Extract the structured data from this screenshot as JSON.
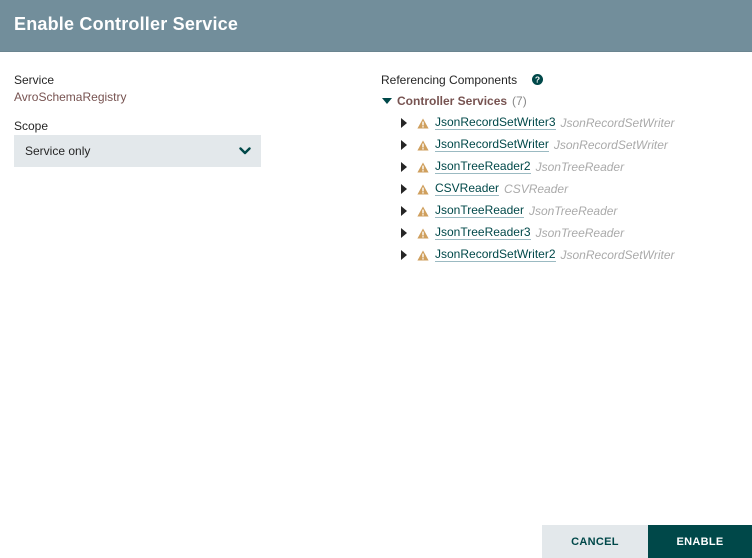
{
  "dialog": {
    "title": "Enable Controller Service"
  },
  "service": {
    "label": "Service",
    "value": "AvroSchemaRegistry"
  },
  "scope": {
    "label": "Scope",
    "selected": "Service only"
  },
  "referencing": {
    "label": "Referencing Components",
    "help_icon": "question-circle-icon",
    "group": {
      "name": "Controller Services",
      "count": "(7)",
      "items": [
        {
          "name": "JsonRecordSetWriter3",
          "type": "JsonRecordSetWriter"
        },
        {
          "name": "JsonRecordSetWriter",
          "type": "JsonRecordSetWriter"
        },
        {
          "name": "JsonTreeReader2",
          "type": "JsonTreeReader"
        },
        {
          "name": "CSVReader",
          "type": "CSVReader"
        },
        {
          "name": "JsonTreeReader",
          "type": "JsonTreeReader"
        },
        {
          "name": "JsonTreeReader3",
          "type": "JsonTreeReader"
        },
        {
          "name": "JsonRecordSetWriter2",
          "type": "JsonRecordSetWriter"
        }
      ]
    }
  },
  "buttons": {
    "cancel": "CANCEL",
    "enable": "ENABLE"
  },
  "colors": {
    "header": "#728e9b",
    "accent": "#004849",
    "service_value": "#775351",
    "warning": "#cf9f5d",
    "select_bg": "#e3e8eb"
  }
}
